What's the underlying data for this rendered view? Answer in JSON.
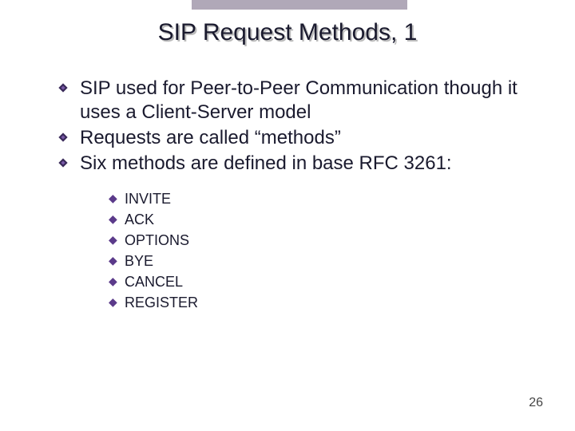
{
  "slide": {
    "title": "SIP Request Methods, 1",
    "page_number": "26"
  },
  "bullets": {
    "lvl1": [
      "SIP used for Peer-to-Peer Communication though it uses a Client-Server model",
      "Requests are called “methods”",
      "Six methods are defined in base RFC 3261:"
    ],
    "lvl2": [
      "INVITE",
      "ACK",
      "OPTIONS",
      "BYE",
      "CANCEL",
      "REGISTER"
    ]
  }
}
